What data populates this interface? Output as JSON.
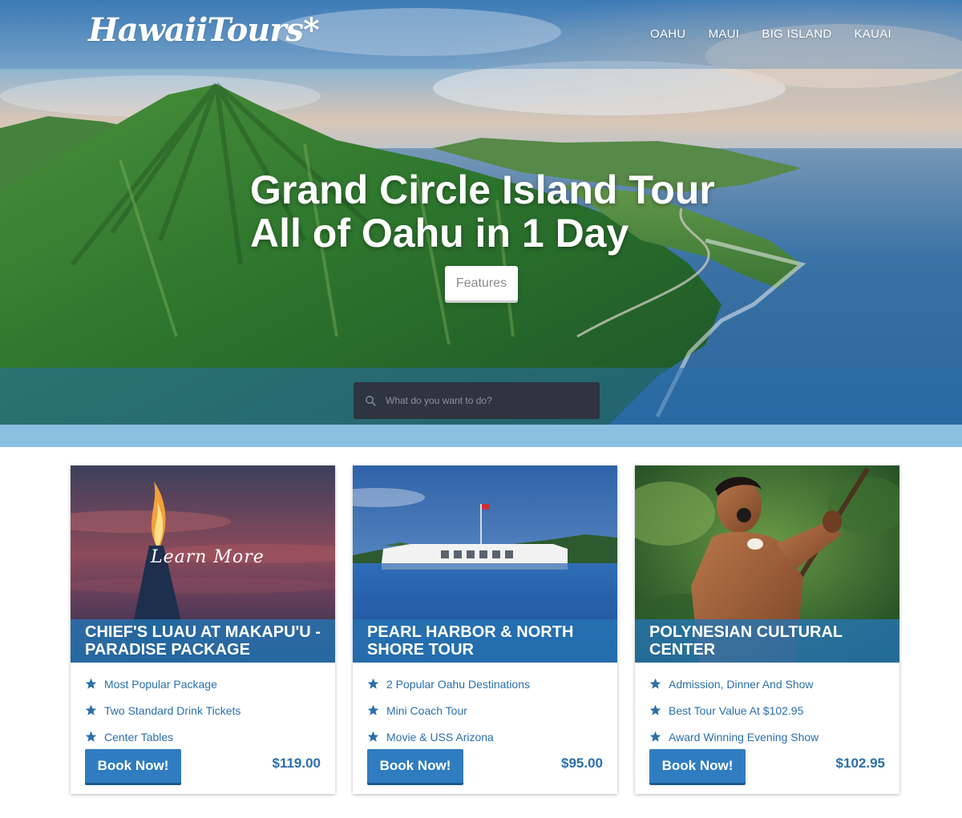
{
  "header": {
    "logo_text": "HawaiiTours*",
    "nav": [
      "OAHU",
      "MAUI",
      "BIG ISLAND",
      "KAUAI"
    ]
  },
  "hero": {
    "headline_line1": "Grand Circle Island Tour",
    "headline_line2": "All of Oahu in 1 Day",
    "features_button": "Features",
    "search_placeholder": "What do you want to do?"
  },
  "cards": [
    {
      "overlay_text": "Learn More",
      "title": "Chief's Luau at Makapu'u - Paradise Package",
      "features": [
        "Most Popular Package",
        "Two Standard Drink Tickets",
        "Center Tables"
      ],
      "button": "Book Now!",
      "price": "$119.00"
    },
    {
      "title": "Pearl Harbor & North Shore Tour",
      "features": [
        "2 Popular Oahu Destinations",
        "Mini Coach Tour",
        "Movie & USS Arizona"
      ],
      "button": "Book Now!",
      "price": "$95.00"
    },
    {
      "title": "Polynesian Cultural Center",
      "features": [
        "Admission, Dinner And Show",
        "Best Tour Value At $102.95",
        "Award Winning Evening Show"
      ],
      "button": "Book Now!",
      "price": "$102.95"
    }
  ],
  "colors": {
    "accent_blue": "#2f7dc0",
    "text_blue": "#2b6fad",
    "strip_blue": "#8cc0e0",
    "search_dark": "#2e3440"
  },
  "icons": [
    "search-icon",
    "star-icon"
  ]
}
